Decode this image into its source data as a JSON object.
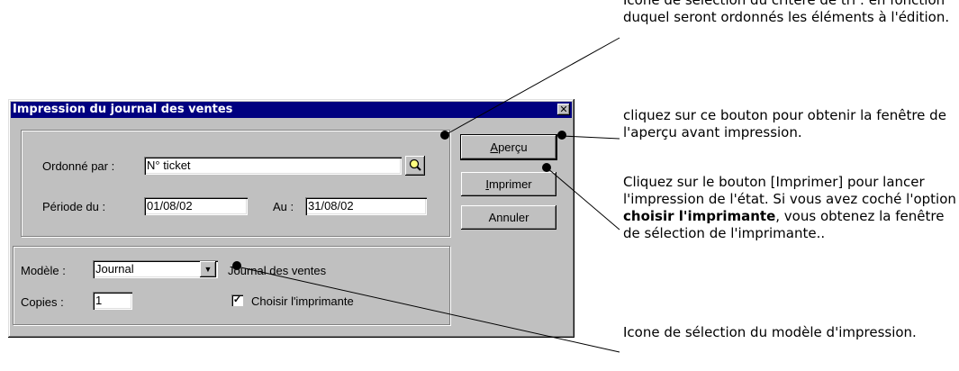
{
  "annotations": {
    "a1": "Icone de sélection du critère de tri : en fonction duquel seront ordonnés les éléments à l'édition.",
    "a2": "cliquez sur ce bouton pour obtenir la fenêtre de l'aperçu avant impression.",
    "a3_pre": "Cliquez sur le bouton [Imprimer] pour lancer l'impression de l'état. Si vous avez coché l'option ",
    "a3_bold": "choisir l'imprimante",
    "a3_post": ", vous obtenez la fenêtre de sélection de l'imprimante..",
    "a4": "Icone de sélection du modèle d'impression."
  },
  "dialog": {
    "title": "Impression du journal des ventes",
    "close_glyph": "✕",
    "ordonne_label": "Ordonné par :",
    "ordonne_value": "N° ticket",
    "periode_label": "Période du :",
    "periode_from": "01/08/02",
    "au_label": "Au :",
    "periode_to": "31/08/02",
    "modele_label": "Modèle :",
    "modele_value": "Journal",
    "modele_desc": "Journal des ventes",
    "copies_label": "Copies :",
    "copies_value": "1",
    "choisir_label": "Choisir l'imprimante",
    "choisir_checked": true,
    "buttons": {
      "apercu_first": "A",
      "apercu_rest": "perçu",
      "imprimer_first": "I",
      "imprimer_rest": "mprimer",
      "annuler": "Annuler"
    }
  },
  "colors": {
    "titlebar": "#000080",
    "face": "#c0c0c0"
  },
  "icons": {
    "search": "magnifier-icon",
    "dropdown": "chevron-down-icon"
  }
}
